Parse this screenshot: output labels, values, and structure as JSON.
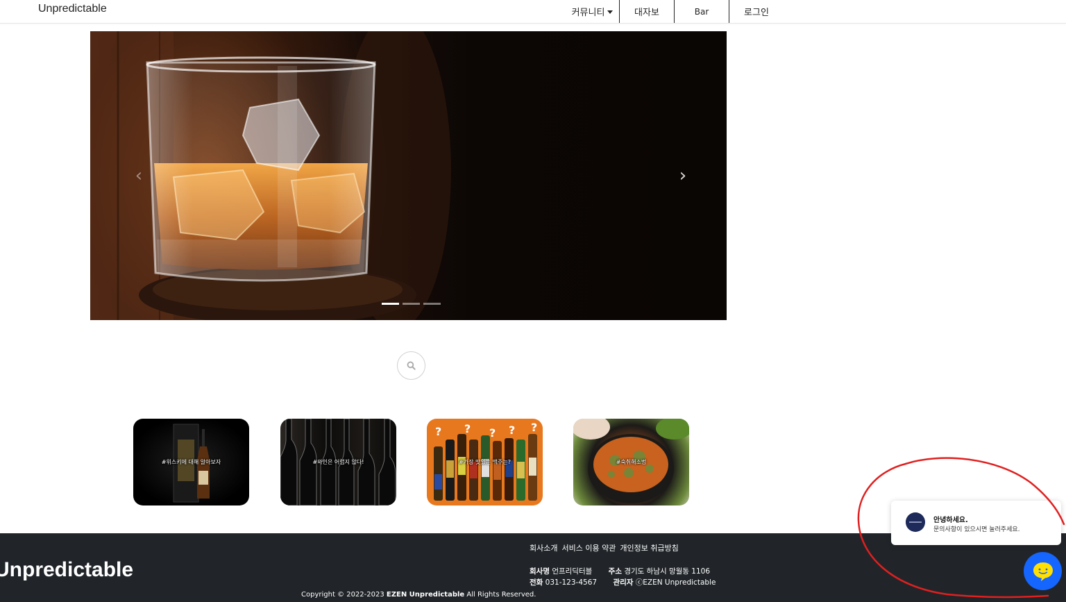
{
  "navbar": {
    "brand": "Unpredictable",
    "community": "커뮤니티",
    "daejabo": "대자보",
    "bar": "Bar",
    "login": "로그인"
  },
  "carousel": {
    "prev_icon": "chevron-left-icon",
    "next_icon": "chevron-right-icon",
    "prev_glyph": "‹",
    "next_glyph": "›",
    "slide_count": 3,
    "active_slide": 1
  },
  "search": {
    "icon": "search-icon"
  },
  "cards": [
    {
      "label": "#위스키에 대해 알아보자"
    },
    {
      "label": "#와인은 어렵지 않다!"
    },
    {
      "label": "#가장 맛있는 맥주는?"
    },
    {
      "label": "#숙취해소법"
    }
  ],
  "footer": {
    "brand": "Unpredictable",
    "links": [
      "회사소개",
      "서비스 이용 약관",
      "개인정보 취급방침"
    ],
    "company_label": "회사명",
    "company_value": "언프리딕터블",
    "address_label": "주소",
    "address_value": "경기도 하남시 망월동 1106",
    "phone_label": "전화",
    "phone_value": "031-123-4567",
    "admin_label": "관리자",
    "admin_value": "ⓒEZEN Unpredictable",
    "copyright_prefix": "Copyright © 2022-2023",
    "copyright_brand": "EZEN Unpredictable",
    "copyright_suffix": "All Rights Reserved."
  },
  "chat": {
    "title": "안녕하세요.",
    "message": "문의사항이 있으시면 눌러주세요.",
    "button_icon": "chat-bubble-icon"
  },
  "colors": {
    "footer_bg": "#212529",
    "chat_button": "#1565ff",
    "card_beer_bg": "#e8781e",
    "annotation": "#e02020"
  }
}
